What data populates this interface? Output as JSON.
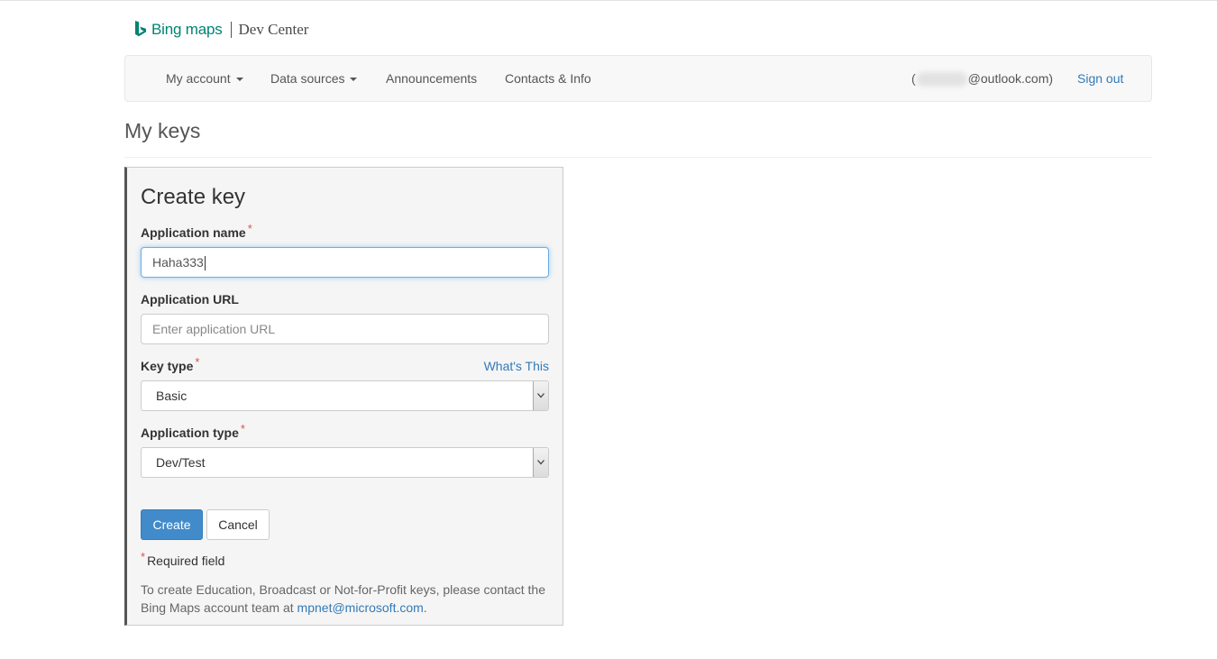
{
  "brand": {
    "logo_icon": "bing-logo-icon",
    "name": "Bing maps",
    "section": "Dev Center",
    "accent": "#008373"
  },
  "nav": {
    "items": [
      {
        "label": "My account",
        "dropdown": true
      },
      {
        "label": "Data sources",
        "dropdown": true
      },
      {
        "label": "Announcements",
        "dropdown": false
      },
      {
        "label": "Contacts & Info",
        "dropdown": false
      }
    ],
    "email_prefix": "(",
    "email_suffix": "@outlook.com)",
    "sign_out": "Sign out"
  },
  "page": {
    "title": "My keys"
  },
  "form": {
    "title": "Create key",
    "app_name": {
      "label": "Application name",
      "value": "Haha333"
    },
    "app_url": {
      "label": "Application URL",
      "value": "",
      "placeholder": "Enter application URL"
    },
    "key_type": {
      "label": "Key type",
      "selected": "Basic",
      "help_link": "What's This"
    },
    "app_type": {
      "label": "Application type",
      "selected": "Dev/Test"
    },
    "required_mark": "*",
    "create_button": "Create",
    "cancel_button": "Cancel",
    "required_note": "Required field",
    "help_text": "To create Education, Broadcast or Not-for-Profit keys, please contact the Bing Maps account team at",
    "help_email": "mpnet@microsoft.com",
    "help_end": "."
  },
  "colors": {
    "primary": "#428bca",
    "link": "#337ab7",
    "required": "#d9534f"
  }
}
